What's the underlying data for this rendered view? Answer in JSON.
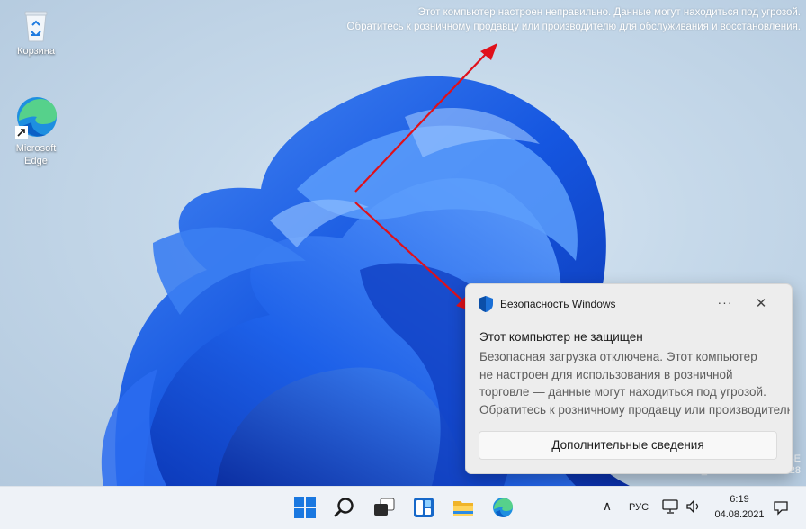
{
  "desktop": {
    "icons": [
      {
        "label": "Корзина"
      },
      {
        "label_line1": "Microsoft",
        "label_line2": "Edge"
      }
    ],
    "warning_watermark": {
      "line1": "Этот компьютер настроен неправильно. Данные могут находиться под угрозой.",
      "line2": "Обратитесь к розничному продавцу или производителю для обслуживания и восстановления."
    },
    "build_watermark": {
      "line1": "SE",
      "line2": "Build 22000.co_release.210604-1628"
    }
  },
  "notification": {
    "app_name": "Безопасность Windows",
    "title": "Этот компьютер не защищен",
    "body_lines": [
      "Безопасная загрузка отключена. Этот компьютер",
      "не настроен для использования в розничной",
      "торговле — данные могут находиться под угрозой.",
      "Обратитесь к розничному продавцу или производителю"
    ],
    "more_label": "···",
    "close_label": "✕",
    "action_label": "Дополнительные сведения"
  },
  "taskbar": {
    "apps": [
      "start-icon",
      "search-icon",
      "task-view-icon",
      "widgets-icon",
      "file-explorer-icon",
      "edge-icon"
    ],
    "tray": {
      "chevron": "∧",
      "language": "РУС",
      "time": "6:19",
      "date": "04.08.2021"
    }
  },
  "colors": {
    "accent": "#0067c0",
    "arrow": "#e0101a",
    "bloom": "#1a5fe0"
  }
}
